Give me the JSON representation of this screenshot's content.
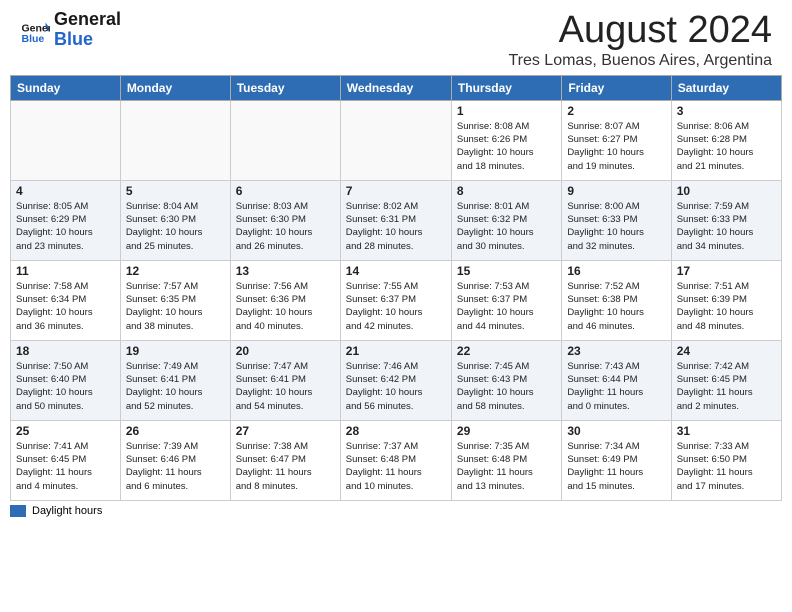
{
  "header": {
    "logo_general": "General",
    "logo_blue": "Blue",
    "month_year": "August 2024",
    "location": "Tres Lomas, Buenos Aires, Argentina"
  },
  "weekdays": [
    "Sunday",
    "Monday",
    "Tuesday",
    "Wednesday",
    "Thursday",
    "Friday",
    "Saturday"
  ],
  "legend": {
    "label": "Daylight hours"
  },
  "weeks": [
    [
      {
        "day": "",
        "info": ""
      },
      {
        "day": "",
        "info": ""
      },
      {
        "day": "",
        "info": ""
      },
      {
        "day": "",
        "info": ""
      },
      {
        "day": "1",
        "info": "Sunrise: 8:08 AM\nSunset: 6:26 PM\nDaylight: 10 hours\nand 18 minutes."
      },
      {
        "day": "2",
        "info": "Sunrise: 8:07 AM\nSunset: 6:27 PM\nDaylight: 10 hours\nand 19 minutes."
      },
      {
        "day": "3",
        "info": "Sunrise: 8:06 AM\nSunset: 6:28 PM\nDaylight: 10 hours\nand 21 minutes."
      }
    ],
    [
      {
        "day": "4",
        "info": "Sunrise: 8:05 AM\nSunset: 6:29 PM\nDaylight: 10 hours\nand 23 minutes."
      },
      {
        "day": "5",
        "info": "Sunrise: 8:04 AM\nSunset: 6:30 PM\nDaylight: 10 hours\nand 25 minutes."
      },
      {
        "day": "6",
        "info": "Sunrise: 8:03 AM\nSunset: 6:30 PM\nDaylight: 10 hours\nand 26 minutes."
      },
      {
        "day": "7",
        "info": "Sunrise: 8:02 AM\nSunset: 6:31 PM\nDaylight: 10 hours\nand 28 minutes."
      },
      {
        "day": "8",
        "info": "Sunrise: 8:01 AM\nSunset: 6:32 PM\nDaylight: 10 hours\nand 30 minutes."
      },
      {
        "day": "9",
        "info": "Sunrise: 8:00 AM\nSunset: 6:33 PM\nDaylight: 10 hours\nand 32 minutes."
      },
      {
        "day": "10",
        "info": "Sunrise: 7:59 AM\nSunset: 6:33 PM\nDaylight: 10 hours\nand 34 minutes."
      }
    ],
    [
      {
        "day": "11",
        "info": "Sunrise: 7:58 AM\nSunset: 6:34 PM\nDaylight: 10 hours\nand 36 minutes."
      },
      {
        "day": "12",
        "info": "Sunrise: 7:57 AM\nSunset: 6:35 PM\nDaylight: 10 hours\nand 38 minutes."
      },
      {
        "day": "13",
        "info": "Sunrise: 7:56 AM\nSunset: 6:36 PM\nDaylight: 10 hours\nand 40 minutes."
      },
      {
        "day": "14",
        "info": "Sunrise: 7:55 AM\nSunset: 6:37 PM\nDaylight: 10 hours\nand 42 minutes."
      },
      {
        "day": "15",
        "info": "Sunrise: 7:53 AM\nSunset: 6:37 PM\nDaylight: 10 hours\nand 44 minutes."
      },
      {
        "day": "16",
        "info": "Sunrise: 7:52 AM\nSunset: 6:38 PM\nDaylight: 10 hours\nand 46 minutes."
      },
      {
        "day": "17",
        "info": "Sunrise: 7:51 AM\nSunset: 6:39 PM\nDaylight: 10 hours\nand 48 minutes."
      }
    ],
    [
      {
        "day": "18",
        "info": "Sunrise: 7:50 AM\nSunset: 6:40 PM\nDaylight: 10 hours\nand 50 minutes."
      },
      {
        "day": "19",
        "info": "Sunrise: 7:49 AM\nSunset: 6:41 PM\nDaylight: 10 hours\nand 52 minutes."
      },
      {
        "day": "20",
        "info": "Sunrise: 7:47 AM\nSunset: 6:41 PM\nDaylight: 10 hours\nand 54 minutes."
      },
      {
        "day": "21",
        "info": "Sunrise: 7:46 AM\nSunset: 6:42 PM\nDaylight: 10 hours\nand 56 minutes."
      },
      {
        "day": "22",
        "info": "Sunrise: 7:45 AM\nSunset: 6:43 PM\nDaylight: 10 hours\nand 58 minutes."
      },
      {
        "day": "23",
        "info": "Sunrise: 7:43 AM\nSunset: 6:44 PM\nDaylight: 11 hours\nand 0 minutes."
      },
      {
        "day": "24",
        "info": "Sunrise: 7:42 AM\nSunset: 6:45 PM\nDaylight: 11 hours\nand 2 minutes."
      }
    ],
    [
      {
        "day": "25",
        "info": "Sunrise: 7:41 AM\nSunset: 6:45 PM\nDaylight: 11 hours\nand 4 minutes."
      },
      {
        "day": "26",
        "info": "Sunrise: 7:39 AM\nSunset: 6:46 PM\nDaylight: 11 hours\nand 6 minutes."
      },
      {
        "day": "27",
        "info": "Sunrise: 7:38 AM\nSunset: 6:47 PM\nDaylight: 11 hours\nand 8 minutes."
      },
      {
        "day": "28",
        "info": "Sunrise: 7:37 AM\nSunset: 6:48 PM\nDaylight: 11 hours\nand 10 minutes."
      },
      {
        "day": "29",
        "info": "Sunrise: 7:35 AM\nSunset: 6:48 PM\nDaylight: 11 hours\nand 13 minutes."
      },
      {
        "day": "30",
        "info": "Sunrise: 7:34 AM\nSunset: 6:49 PM\nDaylight: 11 hours\nand 15 minutes."
      },
      {
        "day": "31",
        "info": "Sunrise: 7:33 AM\nSunset: 6:50 PM\nDaylight: 11 hours\nand 17 minutes."
      }
    ]
  ]
}
